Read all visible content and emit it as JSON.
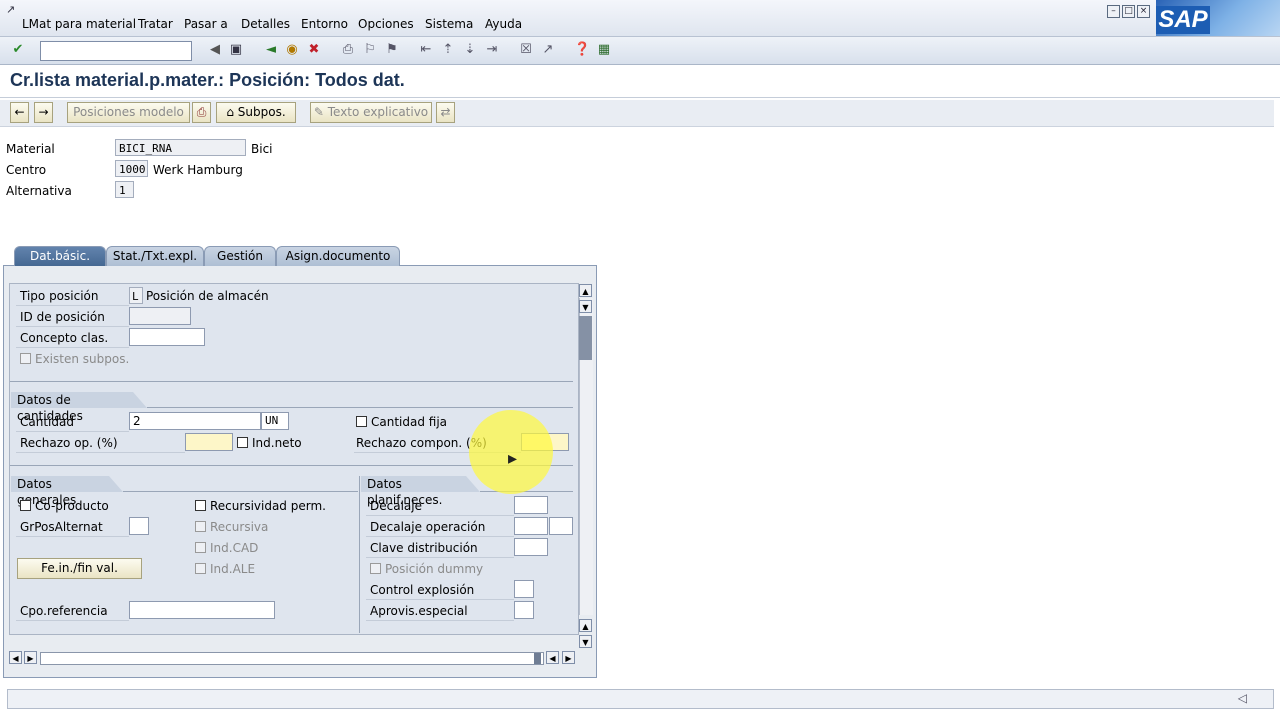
{
  "menubar": {
    "items": [
      "LMat para material",
      "Tratar",
      "Pasar a",
      "Detalles",
      "Entorno",
      "Opciones",
      "Sistema",
      "Ayuda"
    ],
    "logo": "SAP"
  },
  "title": "Cr.lista material.p.mater.: Posición: Todos dat.",
  "app_toolbar": {
    "posiciones_modelo": "Posiciones modelo",
    "subpos": "Subpos.",
    "texto_explicativo": "Texto explicativo"
  },
  "header": {
    "material_label": "Material",
    "material_value": "BICI_RNA",
    "material_desc": "Bici",
    "centro_label": "Centro",
    "centro_value": "1000",
    "centro_desc": "Werk Hamburg",
    "alternativa_label": "Alternativa",
    "alternativa_value": "1"
  },
  "tabs": [
    "Dat.básic.",
    "Stat./Txt.expl.",
    "Gestión",
    "Asign.documento"
  ],
  "basic": {
    "tipo_posicion_label": "Tipo posición",
    "tipo_posicion_value": "L",
    "tipo_posicion_desc": "Posición de almacén",
    "id_posicion_label": "ID de posición",
    "concepto_clas_label": "Concepto clas.",
    "existen_subpos_label": "Existen subpos."
  },
  "cantidades": {
    "title": "Datos de cantidades",
    "cantidad_label": "Cantidad",
    "cantidad_value": "2",
    "unidad_value": "UN",
    "cantidad_fija_label": "Cantidad fija",
    "rechazo_op_label": "Rechazo op. (%)",
    "ind_neto_label": "Ind.neto",
    "rechazo_compon_label": "Rechazo compon. (%)"
  },
  "generales": {
    "title": "Datos generales",
    "coproducto_label": "Co-producto",
    "recursividad_label": "Recursividad perm.",
    "grpos_label": "GrPosAlternat",
    "recursiva_label": "Recursiva",
    "indcad_label": "Ind.CAD",
    "fein_button": "Fe.in./fin val.",
    "indale_label": "Ind.ALE",
    "cpo_referencia_label": "Cpo.referencia"
  },
  "planif": {
    "title": "Datos planif.neces.",
    "decalaje_label": "Decalaje",
    "decalaje_op_label": "Decalaje operación",
    "clave_dist_label": "Clave distribución",
    "posicion_dummy_label": "Posición dummy",
    "control_explosion_label": "Control explosión",
    "aprovis_label": "Aprovis.especial"
  },
  "colors": {
    "accent": "#456892",
    "highlight": "#fff83c"
  }
}
